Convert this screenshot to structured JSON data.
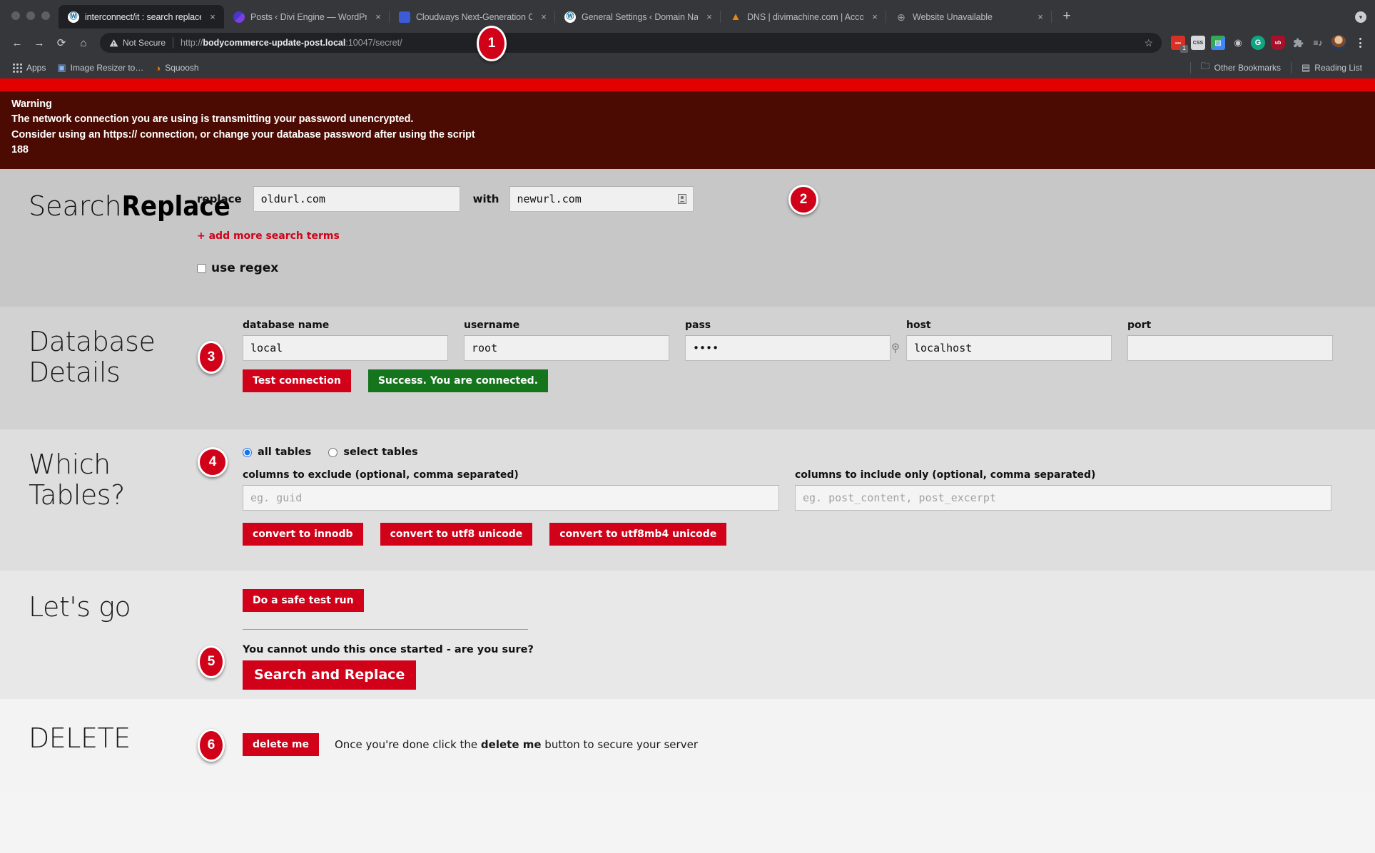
{
  "browser": {
    "tabs": [
      {
        "title": "interconnect/it : search replace",
        "favicon": "wordpress-icon",
        "active": true
      },
      {
        "title": "Posts ‹ Divi Engine — WordPress",
        "favicon": "divi-icon",
        "active": false
      },
      {
        "title": "Cloudways Next-Generation Cl",
        "favicon": "cloudways-icon",
        "active": false
      },
      {
        "title": "General Settings ‹ Domain Nam",
        "favicon": "wordpress-icon",
        "active": false
      },
      {
        "title": "DNS | divimachine.com | Accou",
        "favicon": "dns-icon",
        "active": false
      },
      {
        "title": "Website Unavailable",
        "favicon": "globe-icon",
        "active": false
      }
    ],
    "close_label": "×",
    "new_tab_label": "+",
    "tabstrip_caret": "▾",
    "nav": {
      "back": "←",
      "forward": "→",
      "reload": "⟳",
      "home": "⌂"
    },
    "omnibox": {
      "security_label": "Not Secure",
      "security_icon": "warning-triangle-icon",
      "url_scheme": "http://",
      "url_host": "bodycommerce-update-post.local",
      "url_rest": ":10047/secret/",
      "star": "☆"
    },
    "extensions": [
      {
        "name": "red-dots-extension-icon",
        "glyph": "•••",
        "color": "#d93025",
        "badge": "1"
      },
      {
        "name": "css-extension-icon",
        "glyph": "CSS",
        "color": "#cfd2d6"
      },
      {
        "name": "chart-extension-icon",
        "glyph": "▨",
        "color": "#34a853"
      },
      {
        "name": "camera-extension-icon",
        "glyph": "◉",
        "color": "#c7cacd"
      },
      {
        "name": "grammarly-extension-icon",
        "glyph": "G",
        "color": "#11a683"
      },
      {
        "name": "ublock-extension-icon",
        "glyph": "ub",
        "color": "#a5112b"
      },
      {
        "name": "puzzle-extensions-icon",
        "glyph": "🧩",
        "color": "#9aa0a6"
      },
      {
        "name": "media-list-icon",
        "glyph": "≡♪",
        "color": "#c5c8cc"
      }
    ],
    "bookmarks": [
      {
        "label": "Apps",
        "icon": "apps-grid-icon"
      },
      {
        "label": "Image Resizer to…",
        "icon": "image-resizer-icon"
      },
      {
        "label": "Squoosh",
        "icon": "squoosh-icon"
      }
    ],
    "bookmarks_right": [
      {
        "label": "Other Bookmarks",
        "icon": "folder-icon"
      },
      {
        "label": "Reading List",
        "icon": "reading-list-icon"
      }
    ]
  },
  "warning": {
    "heading": "Warning",
    "line1": "The network connection you are using is transmitting your password unencrypted.",
    "line2": "Consider using an https:// connection, or change your database password after using the script",
    "line3": "188",
    "strip_color": "#e20000",
    "body_color": "#4c0b02"
  },
  "search_replace": {
    "title_light": "Search",
    "title_bold": "Replace",
    "replace_label": "replace",
    "replace_value": "oldurl.com",
    "replace_placeholder": "",
    "with_label": "with",
    "with_value": "newurl.com",
    "with_placeholder": "",
    "with_field_icon": "autofill-contact-icon",
    "add_more_label": "+ add more search terms",
    "regex_label": "use regex",
    "regex_checked": false,
    "badge": "2"
  },
  "database": {
    "title_line1": "Database",
    "title_line2": "Details",
    "badge": "3",
    "fields": [
      {
        "name": "database-name",
        "label": "database name",
        "value": "local",
        "type": "text"
      },
      {
        "name": "username",
        "label": "username",
        "value": "root",
        "type": "text"
      },
      {
        "name": "pass",
        "label": "pass",
        "value": "••••",
        "type": "password",
        "icon": "password-key-icon"
      },
      {
        "name": "host",
        "label": "host",
        "value": "localhost",
        "type": "text"
      },
      {
        "name": "port",
        "label": "port",
        "value": "",
        "type": "text"
      }
    ],
    "test_button": "Test connection",
    "status_message": "Success. You are connected.",
    "status_color": "#14751c"
  },
  "tables": {
    "title": "Which Tables?",
    "badge": "4",
    "radio_all_label": "all tables",
    "radio_select_label": "select tables",
    "radio_selected": "all",
    "exclude_label": "columns to exclude (optional, comma separated)",
    "exclude_placeholder": "eg. guid",
    "exclude_value": "",
    "include_label": "columns to include only (optional, comma separated)",
    "include_placeholder": "eg. post_content, post_excerpt",
    "include_value": "",
    "convert_buttons": [
      "convert to innodb",
      "convert to utf8 unicode",
      "convert to utf8mb4 unicode"
    ]
  },
  "lets_go": {
    "title": "Let's go",
    "badge": "5",
    "test_run_button": "Do a safe test run",
    "confirm_text": "You cannot undo this once started - are you sure?",
    "main_button": "Search and Replace"
  },
  "delete": {
    "title": "DELETE",
    "badge": "6",
    "button": "delete me",
    "note_prefix": "Once you're done click the ",
    "note_bold": "delete me",
    "note_suffix": " button to secure your server"
  },
  "theme": {
    "accent_red": "#d00118",
    "warning_red": "#e20000",
    "success_green": "#14751c",
    "chrome_bg": "#35373b",
    "omnibox_bg": "#202124"
  }
}
